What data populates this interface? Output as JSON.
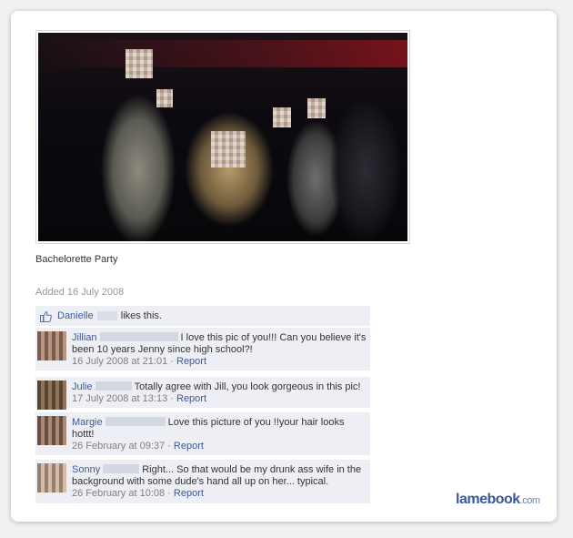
{
  "photo": {
    "caption": "Bachelorette Party",
    "added": "Added 16 July 2008"
  },
  "likes": {
    "name": "Danielle",
    "text": "likes this."
  },
  "comments": [
    {
      "author": "Jillian",
      "text": "I love this pic of you!!! Can you believe it's been 10 years Jenny since high school?!",
      "timestamp": "16 July 2008 at 21:01",
      "separator": "·",
      "report": "Report"
    },
    {
      "author": "Julie",
      "text": "Totally agree with Jill, you look gorgeous in this pic!",
      "timestamp": "17 July 2008 at 13:13",
      "separator": "·",
      "report": "Report"
    },
    {
      "author": "Margie",
      "text": "Love this picture of you !!your hair looks hottt!",
      "timestamp": "26 February at 09:37",
      "separator": "·",
      "report": "Report"
    },
    {
      "author": "Sonny",
      "text": "Right... So that would be my drunk ass wife in the background with some dude's hand all up on her... typical.",
      "timestamp": "26 February at 10:08",
      "separator": "·",
      "report": "Report"
    }
  ],
  "watermark": {
    "brand": "lamebook",
    "tld": ".com"
  },
  "colors": {
    "link": "#3b5998",
    "comment_bg": "#edeff4"
  }
}
